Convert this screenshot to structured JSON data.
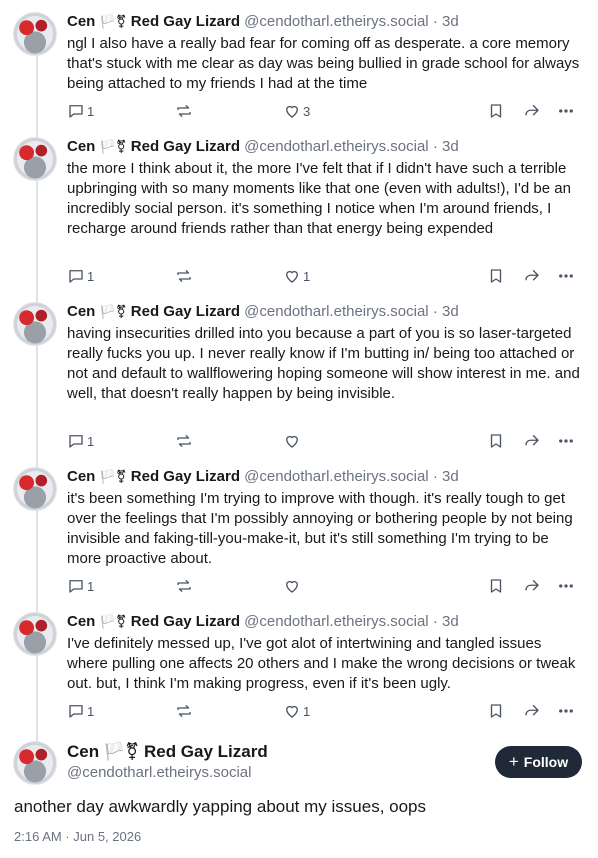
{
  "author": {
    "display_name": "Cen",
    "flags": "🏳️⚧",
    "suffix": "Red Gay Lizard",
    "handle": "@cendotharl.etheirys.social"
  },
  "posts": [
    {
      "time": "3d",
      "text": "ngl I also have a really bad fear for coming off as desperate. a core memory that's stuck with me clear as day was being bullied in grade school for always being attached to my friends I had at the time",
      "replies": "1",
      "likes": "3"
    },
    {
      "time": "3d",
      "text": "the more I think about it, the more I've felt that if I didn't have such a terrible upbringing with so many moments like that one (even with adults!), I'd be an incredibly social person. it's something I notice when I'm around friends, I recharge around friends rather than that energy being expended",
      "replies": "1",
      "likes": "1"
    },
    {
      "time": "3d",
      "text": "having insecurities drilled into you because a part of you is so laser-targeted really fucks you up. I never really know if I'm butting in/ being too attached or not and default to wallflowering hoping someone will show interest in me. and well, that doesn't really happen by being invisible.",
      "replies": "1",
      "likes": ""
    },
    {
      "time": "3d",
      "text": "it's been something I'm trying to improve with though. it's really tough to get over the feelings that I'm possibly annoying or bothering people by not being invisible and faking-till-you-make-it, but it's still something I'm trying to be more proactive about.",
      "replies": "1",
      "likes": ""
    },
    {
      "time": "3d",
      "text": "I've definitely messed up, I've got alot of intertwining and tangled issues where pulling one affects 20 others and I make the wrong decisions or tweak out. but, I think I'm making progress, even if it's been ugly.",
      "replies": "1",
      "likes": "1"
    }
  ],
  "main_post": {
    "display_name": "Cen 🏳️⚧ Red Gay Lizard",
    "handle": "@cendotharl.etheirys.social",
    "follow_label": "Follow",
    "follow_plus": "+",
    "text": "another day awkwardly yapping about my issues, oops",
    "date": "2:16 AM · Jun 5, 2026"
  },
  "icons": {
    "reply": "reply-icon",
    "repost": "repost-icon",
    "like": "heart-icon",
    "bookmark": "bookmark-icon",
    "share": "share-icon",
    "more": "more-icon"
  },
  "colors": {
    "follow_bg": "#1f2937",
    "muted": "#6b7280"
  }
}
